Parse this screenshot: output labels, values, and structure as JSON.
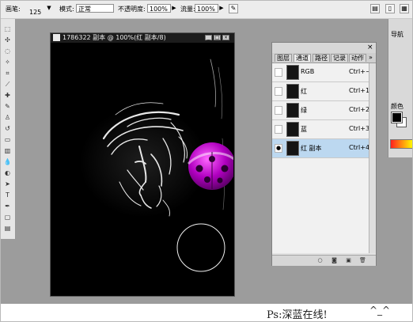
{
  "options_bar": {
    "brush_label": "画笔:",
    "brush_size": "125",
    "mode_label": "模式:",
    "mode_value": "正常",
    "opacity_label": "不透明度:",
    "opacity_value": "100%",
    "flow_label": "流量:",
    "flow_value": "100%"
  },
  "document": {
    "title": "1786322 副本 @ 100%(红 副本/8)"
  },
  "channels_panel": {
    "tabs": [
      {
        "label": "图层"
      },
      {
        "label": "通道"
      },
      {
        "label": "路径"
      },
      {
        "label": "记录"
      },
      {
        "label": "动作"
      }
    ],
    "rows": [
      {
        "name": "RGB",
        "shortcut": "Ctrl+~",
        "visible": false,
        "selected": false
      },
      {
        "name": "红",
        "shortcut": "Ctrl+1",
        "visible": false,
        "selected": false
      },
      {
        "name": "绿",
        "shortcut": "Ctrl+2",
        "visible": false,
        "selected": false
      },
      {
        "name": "蓝",
        "shortcut": "Ctrl+3",
        "visible": false,
        "selected": false
      },
      {
        "name": "红 副本",
        "shortcut": "Ctrl+4",
        "visible": true,
        "selected": true
      }
    ]
  },
  "dock": {
    "navigator_tab": "导航",
    "color_tab": "颜色"
  },
  "caption": {
    "text": "Ps:深蓝在线!",
    "emote": "^_^"
  },
  "colors": {
    "workspace": "#9c9c9c",
    "ladybug": "#b000c0",
    "selection_row": "#bcd8f0"
  }
}
